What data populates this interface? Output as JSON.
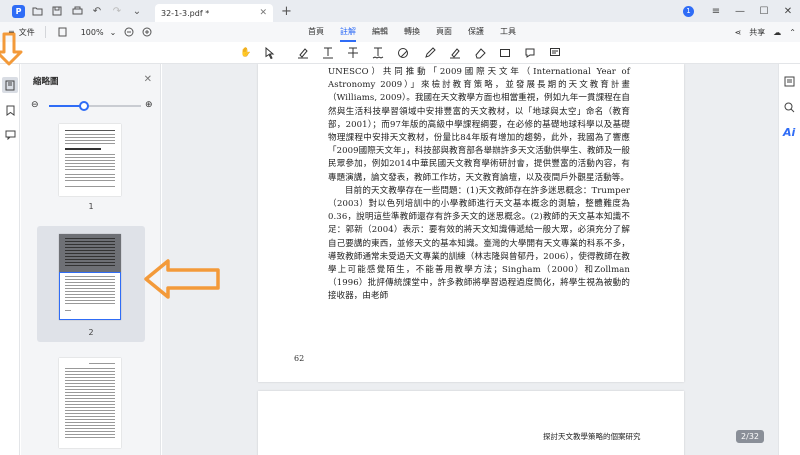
{
  "titlebar": {
    "tab_title": "32-1-3.pdf *",
    "user_initial": "1"
  },
  "toolbar2": {
    "file_label": "文件",
    "zoom_value": "100%",
    "menu_tabs": [
      "首頁",
      "註解",
      "編輯",
      "轉換",
      "頁面",
      "保護",
      "工具"
    ],
    "active_tab": "註解",
    "share_label": "共享"
  },
  "thumbnail_panel": {
    "title": "縮略圖",
    "zoom_fraction": 0.38,
    "thumbs": [
      {
        "label": "1"
      },
      {
        "label": "2"
      },
      {
        "label": ""
      }
    ]
  },
  "document": {
    "page_paragraph_1": "UNESCO）共同推動「2009國際天文年（International Year of Astronomy 2009）」來檢討教育策略，並發展長期的天文教育計畫（Williams, 2009）。我國在天文教學方面也相當重視，例如九年一貫課程在自然與生活科技學習領域中安排豐富的天文教材，以「地球與太空」命名（教育部，2001）；而97年版的高級中學課程綱要，在必修的基礎地球科學以及基礎物理課程中安排天文教材，份量比84年版有增加的趨勢，此外，我國為了響應「2009國際天文年」，科技部與教育部各舉辦許多天文活動供學生、教師及一般民眾參加，例如2014中華民國天文教育學術研討會，提供豐富的活動內容，有專題演講，論文發表，教師工作坊，天文教育論壇，以及夜間戶外觀星活動等。",
    "page_paragraph_2": "目前的天文教學存在一些問題：(1)天文教師存在許多迷思概念：Trumper（2003）對以色列培訓中的小學教師進行天文基本概念的測驗，整體難度為0.36，說明這些準教師還存有許多天文的迷思概念。(2)教師的天文基本知識不足：郭新（2004）表示：要有效的將天文知識傳遞給一般大眾，必須充分了解自己要講的東西，並修天文的基本知識。臺灣的大學開有天文專業的科系不多，導致教師通常未受過天文專業的訓練（林志隆與曾郁丹，2006），使得教師在教學上可能感覺陌生，不能善用教學方法；Singham（2000）和Zollman（1996）批評傳統課堂中，許多教師將學習過程過度簡化，將學生視為被動的接收器，由老師",
    "page_number": "62",
    "page2_header": "探討天文教學策略的個案研究",
    "page_indicator": "2/32"
  },
  "colors": {
    "accent": "#2f6cf6",
    "arrow": "#f39a3a"
  }
}
